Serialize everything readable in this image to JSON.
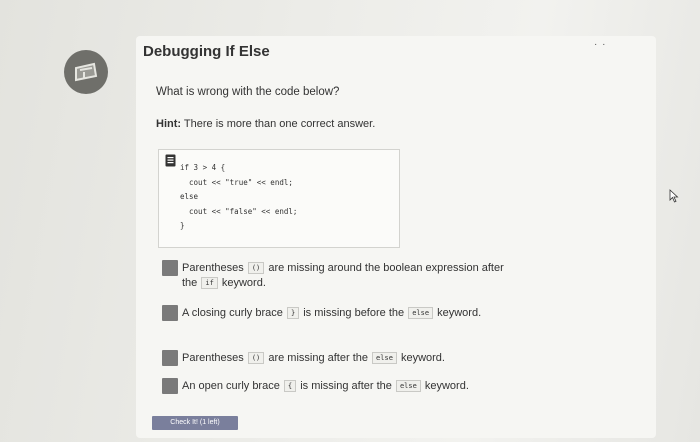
{
  "page": {
    "title": "Debugging If Else",
    "question": "What is wrong with the code below?",
    "hint_label": "Hint:",
    "hint_text": "There is more than one correct answer.",
    "menu_icon": "ellipsis-icon"
  },
  "code": {
    "lines": "if 3 > 4 {\n  cout << \"true\" << endl;\nelse\n  cout << \"false\" << endl;\n}"
  },
  "options": [
    {
      "before": "Parentheses",
      "token1": "()",
      "middle": "are missing around the boolean expression after the",
      "token2": "if",
      "after": "keyword."
    },
    {
      "before": "A closing curly brace",
      "token1": "}",
      "middle": "is missing before the",
      "token2": "else",
      "after": "keyword."
    },
    {
      "before": "Parentheses",
      "token1": "()",
      "middle": "are missing after the",
      "token2": "else",
      "after": "keyword."
    },
    {
      "before": "An open curly brace",
      "token1": "{",
      "middle": "is missing after the",
      "token2": "else",
      "after": "keyword."
    }
  ],
  "check_button": {
    "label": "Check It! (1 left)"
  },
  "colors": {
    "checkbox": "#7a7a7a",
    "button": "#7a7f9c"
  }
}
